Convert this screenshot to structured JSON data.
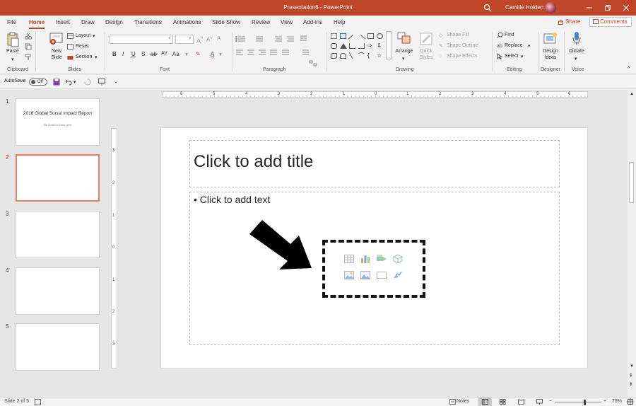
{
  "window": {
    "title": "Presentation6 - PowerPoint",
    "user": "Camille Holden",
    "search_icon": "search-icon",
    "controls": [
      "minimize-icon",
      "restore-icon",
      "close-icon"
    ]
  },
  "tabs": [
    "File",
    "Home",
    "Insert",
    "Draw",
    "Design",
    "Transitions",
    "Animations",
    "Slide Show",
    "Review",
    "View",
    "Add-ins",
    "Help"
  ],
  "active_tab": "Home",
  "share_label": "Share",
  "comments_label": "Comments",
  "ribbon": {
    "clipboard": {
      "label": "Clipboard",
      "paste": "Paste"
    },
    "slides": {
      "label": "Slides",
      "new_slide": "New",
      "new_slide_2": "Slide",
      "layout": "Layout",
      "reset": "Reset",
      "section": "Section"
    },
    "font": {
      "label": "Font",
      "font_name": "",
      "font_size": ""
    },
    "paragraph": {
      "label": "Paragraph"
    },
    "drawing": {
      "label": "Drawing",
      "arrange": "Arrange",
      "quick_styles": "Quick",
      "quick_styles_2": "Styles",
      "shape_fill": "Shape Fill",
      "shape_outline": "Shape Outline",
      "shape_effects": "Shape Effects"
    },
    "editing": {
      "label": "Editing",
      "find": "Find",
      "replace": "Replace",
      "select": "Select"
    },
    "designer": {
      "label": "Designer",
      "design_ideas": "Design",
      "design_ideas_2": "Ideas"
    },
    "voice": {
      "label": "Voice",
      "dictate": "Dictate"
    }
  },
  "qat": {
    "autosave": "AutoSave",
    "toggle": "Off"
  },
  "thumbnails": [
    {
      "num": "1",
      "title": "2018 Global Social Impact Report",
      "subtitle": "We Scaled in Every Level"
    },
    {
      "num": "2",
      "title": "",
      "subtitle": ""
    },
    {
      "num": "3",
      "title": "",
      "subtitle": ""
    },
    {
      "num": "4",
      "title": "",
      "subtitle": ""
    },
    {
      "num": "5",
      "title": "",
      "subtitle": ""
    }
  ],
  "selected_slide": 2,
  "ruler_h": [
    "6",
    "5",
    "4",
    "3",
    "2",
    "1",
    "0",
    "1",
    "2",
    "3",
    "4",
    "5",
    "6"
  ],
  "ruler_v": [
    "3",
    "2",
    "1",
    "0",
    "1",
    "2",
    "3"
  ],
  "slide": {
    "title_placeholder": "Click to add title",
    "body_placeholder": "Click to add text"
  },
  "status": {
    "slide_info": "Slide 2 of 5",
    "notes": "Notes",
    "zoom": "75%"
  }
}
